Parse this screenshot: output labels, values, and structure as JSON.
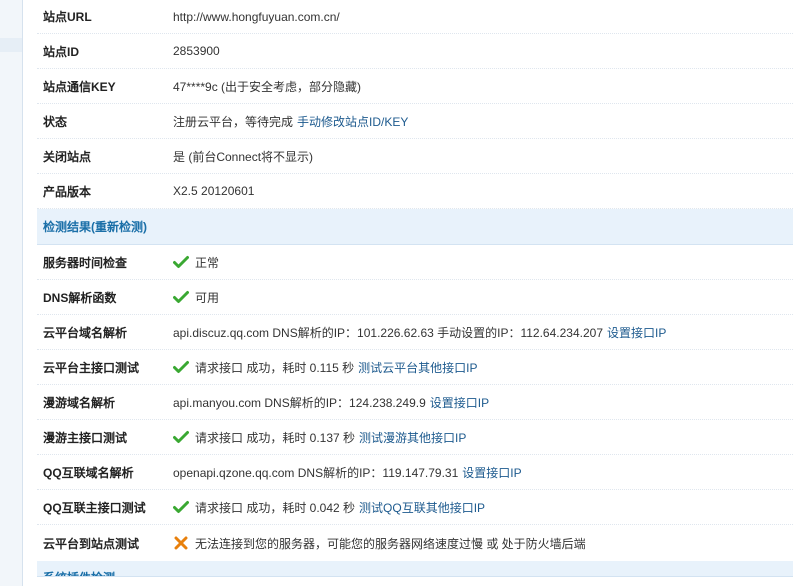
{
  "rows_top": [
    {
      "label": "站点URL",
      "value": "http://www.hongfuyuan.com.cn/"
    },
    {
      "label": "站点ID",
      "value": "2853900"
    },
    {
      "label": "站点通信KEY",
      "value": "47****9c (出于安全考虑，部分隐藏)"
    },
    {
      "label": "状态",
      "value": "注册云平台，等待完成",
      "link": "手动修改站点ID/KEY"
    },
    {
      "label": "关闭站点",
      "value": "是 (前台Connect将不显示)"
    },
    {
      "label": "产品版本",
      "value": "X2.5 20120601"
    }
  ],
  "section_check": {
    "title": "检测结果(重新检测)"
  },
  "checks": {
    "server_time": {
      "label": "服务器时间检查",
      "status": "正常",
      "icon": "check-icon"
    },
    "dns_func": {
      "label": "DNS解析函数",
      "status": "可用",
      "icon": "check-icon"
    },
    "cloud_domain": {
      "label": "云平台域名解析",
      "text": "api.discuz.qq.com DNS解析的IP：101.226.62.63 手动设置的IP：112.64.234.207",
      "link": "设置接口IP"
    },
    "cloud_main": {
      "label": "云平台主接口测试",
      "text": "请求接口 成功，耗时 0.115 秒",
      "link": "测试云平台其他接口IP",
      "icon": "check-icon"
    },
    "manyou_domain": {
      "label": "漫游域名解析",
      "text": "api.manyou.com DNS解析的IP：124.238.249.9",
      "link": "设置接口IP"
    },
    "manyou_main": {
      "label": "漫游主接口测试",
      "text": "请求接口 成功，耗时 0.137 秒",
      "link": "测试漫游其他接口IP",
      "icon": "check-icon"
    },
    "qq_domain": {
      "label": "QQ互联域名解析",
      "text": "openapi.qzone.qq.com DNS解析的IP：119.147.79.31",
      "link": "设置接口IP"
    },
    "qq_main": {
      "label": "QQ互联主接口测试",
      "text": "请求接口 成功，耗时 0.042 秒",
      "link": "测试QQ互联其他接口IP",
      "icon": "check-icon"
    },
    "cloud_to_site": {
      "label": "云平台到站点测试",
      "text": "无法连接到您的服务器，可能您的服务器网络速度过慢 或 处于防火墙后端",
      "icon": "cross-icon"
    }
  },
  "section_next": {
    "title": "系统插件检测"
  },
  "colors": {
    "ok": "#3aa832",
    "error": "#e8800c",
    "link": "#1d5a8e",
    "section_bg": "#e8f2fb",
    "section_text": "#1a6fa8"
  }
}
